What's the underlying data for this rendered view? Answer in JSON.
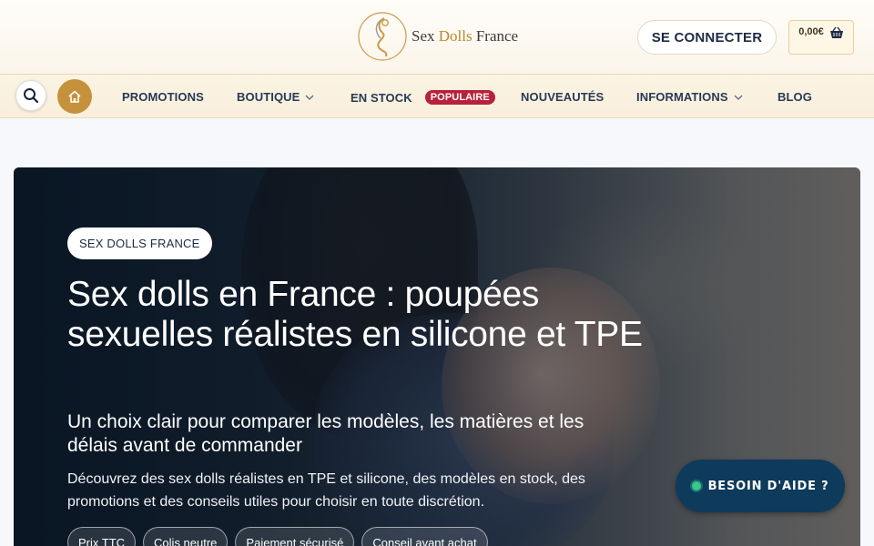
{
  "header": {
    "logo": {
      "text_before": "Sex ",
      "text_accent": "Dolls",
      "text_after": " France"
    },
    "login_label": "SE CONNECTER",
    "cart_amount": "0,00€"
  },
  "nav": {
    "items": [
      {
        "label": "PROMOTIONS",
        "has_dropdown": false
      },
      {
        "label": "BOUTIQUE",
        "has_dropdown": true
      },
      {
        "label": "EN STOCK",
        "has_dropdown": false,
        "badge": "POPULAIRE"
      },
      {
        "label": "NOUVEAUTÉS",
        "has_dropdown": false
      },
      {
        "label": "INFORMATIONS",
        "has_dropdown": true
      },
      {
        "label": "BLOG",
        "has_dropdown": false
      }
    ],
    "icons": {
      "search": "search-icon",
      "home": "home-icon",
      "dropdown": "chevron-down-icon",
      "cart": "basket-icon"
    }
  },
  "hero": {
    "pill": "SEX DOLLS FRANCE",
    "title": "Sex dolls en France : poupées sexuelles réalistes en silicone et TPE",
    "subtitle": "Un choix clair pour comparer les modèles, les matières et les délais avant de commander",
    "description": "Découvrez des sex dolls réalistes en TPE et silicone, des modèles en stock, des promotions et des conseils utiles pour choisir en toute discrétion.",
    "chips": [
      "Prix TTC",
      "Colis neutre",
      "Paiement sécurisé",
      "Conseil avant achat"
    ]
  },
  "help": {
    "label": "BESOIN D'AIDE ?"
  },
  "colors": {
    "accent": "#c5913a",
    "navy": "#0e3a5c",
    "badge": "#b8213b",
    "text": "#283a55"
  }
}
